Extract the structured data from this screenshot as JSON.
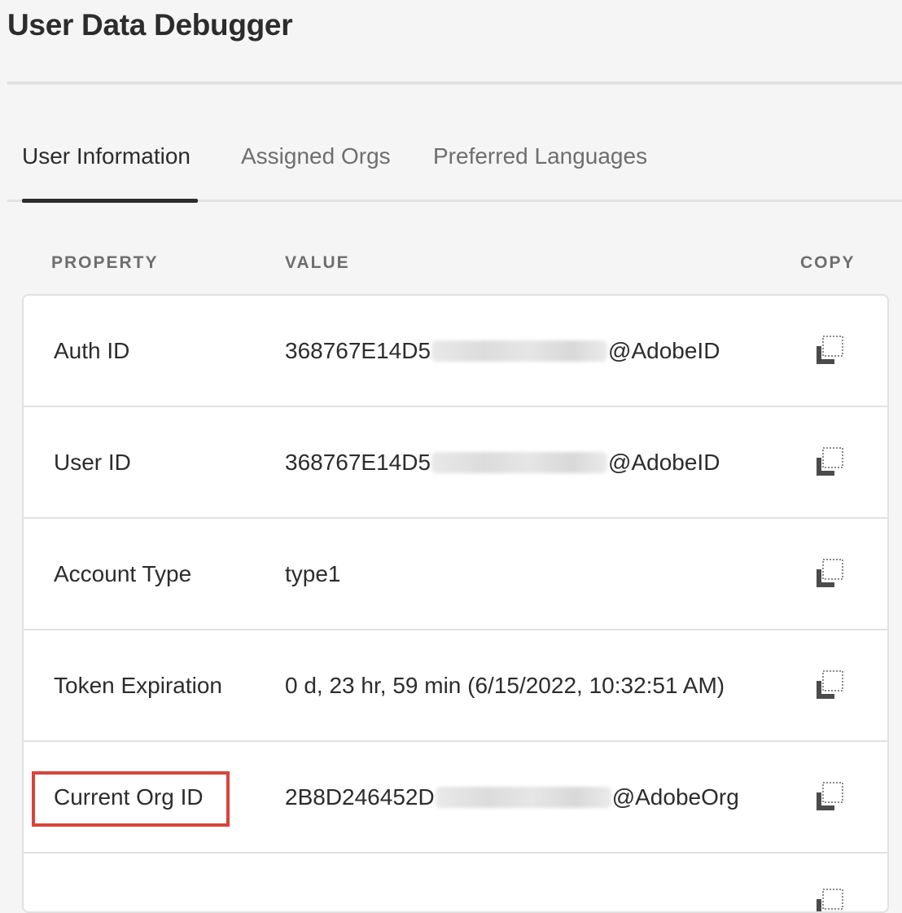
{
  "page": {
    "title": "User Data Debugger"
  },
  "tabs": [
    {
      "label": "User Information",
      "active": true
    },
    {
      "label": "Assigned Orgs",
      "active": false
    },
    {
      "label": "Preferred Languages",
      "active": false
    }
  ],
  "table": {
    "headers": {
      "property": "PROPERTY",
      "value": "VALUE",
      "copy": "COPY"
    },
    "rows": [
      {
        "property": "Auth ID",
        "value_prefix": "368767E14D5",
        "value_suffix": "@AdobeID",
        "value_redacted": true
      },
      {
        "property": "User ID",
        "value_prefix": "368767E14D5",
        "value_suffix": "@AdobeID",
        "value_redacted": true
      },
      {
        "property": "Account Type",
        "value_prefix": "type1",
        "value_suffix": "",
        "value_redacted": false
      },
      {
        "property": "Token Expiration",
        "value_prefix": "0 d, 23 hr, 59 min (6/15/2022, 10:32:51 AM)",
        "value_suffix": "",
        "value_redacted": false
      },
      {
        "property": "Current Org ID",
        "value_prefix": "2B8D246452D",
        "value_suffix": "@AdobeOrg",
        "value_redacted": true,
        "highlighted": true
      }
    ]
  },
  "icons": {
    "copy": "copy-icon"
  },
  "colors": {
    "highlight": "#d9443b",
    "active_tab": "#2c2c2c",
    "inactive_tab": "#6e6e6e"
  }
}
